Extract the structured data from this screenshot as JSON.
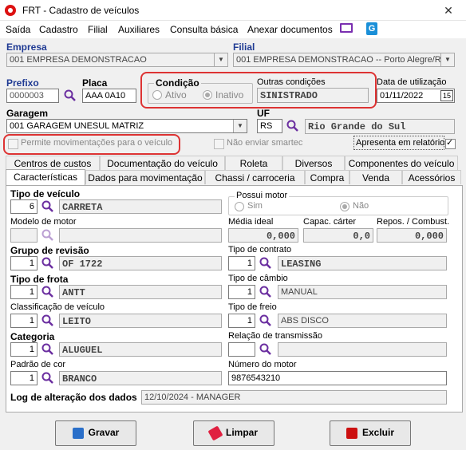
{
  "window": {
    "title": "FRT - Cadastro de veículos"
  },
  "menu": [
    "Saída",
    "Cadastro",
    "Filial",
    "Auxiliares",
    "Consulta básica",
    "Anexar documentos"
  ],
  "empresa": {
    "label": "Empresa",
    "value": "001 EMPRESA DEMONSTRACAO"
  },
  "filial": {
    "label": "Filial",
    "value": "001 EMPRESA DEMONSTRACAO -- Porto Alegre/RS"
  },
  "prefixo": {
    "label": "Prefixo",
    "value": "0000003"
  },
  "placa": {
    "label": "Placa",
    "value": "AAA 0A10"
  },
  "condicao": {
    "label": "Condição",
    "options": [
      "Ativo",
      "Inativo"
    ],
    "selected": "Inativo"
  },
  "outras_condicoes": {
    "label": "Outras condições",
    "value": "SINISTRADO"
  },
  "data_utilizacao": {
    "label": "Data de utilização",
    "value": "01/11/2022",
    "btn": "15"
  },
  "garagem": {
    "label": "Garagem",
    "value": "001 GARAGEM UNESUL MATRIZ"
  },
  "uf": {
    "label": "UF",
    "code": "RS",
    "name": "Rio Grande do Sul"
  },
  "checks": {
    "permite_mov": "Permite movimentações para o veículo",
    "nao_enviar": "Não enviar smartec",
    "apresenta": "Apresenta em relatórios"
  },
  "tabs_row1": [
    "Centros de custos",
    "Documentação do veículo",
    "Roleta",
    "Diversos",
    "Componentes do veículo"
  ],
  "tabs_row2": [
    "Características",
    "Dados para movimentação",
    "Chassi / carroceria",
    "Compra",
    "Venda",
    "Acessórios"
  ],
  "left": {
    "tipo_veiculo": {
      "label": "Tipo de veículo",
      "code": "6",
      "desc": "CARRETA"
    },
    "modelo_motor": {
      "label": "Modelo de motor",
      "code": "",
      "desc": ""
    },
    "grupo_revisao": {
      "label": "Grupo de revisão",
      "code": "1",
      "desc": "OF 1722"
    },
    "tipo_frota": {
      "label": "Tipo de frota",
      "code": "1",
      "desc": "ANTT"
    },
    "classificacao": {
      "label": "Classificação de veículo",
      "code": "1",
      "desc": "LEITO"
    },
    "categoria": {
      "label": "Categoria",
      "code": "1",
      "desc": "ALUGUEL"
    },
    "padrao_cor": {
      "label": "Padrão de cor",
      "code": "1",
      "desc": "BRANCO"
    }
  },
  "right": {
    "possui_motor": {
      "label": "Possui motor",
      "options": [
        "Sim",
        "Não"
      ],
      "selected": "Não"
    },
    "media_ideal": {
      "label": "Média ideal",
      "value": "0,000"
    },
    "capac_carter": {
      "label": "Capac. cárter",
      "value": "0,0"
    },
    "repos_combust": {
      "label": "Repos. / Combust.",
      "value": "0,000"
    },
    "tipo_contrato": {
      "label": "Tipo de contrato",
      "code": "1",
      "desc": "LEASING"
    },
    "tipo_cambio": {
      "label": "Tipo de câmbio",
      "code": "1",
      "desc": "MANUAL"
    },
    "tipo_freio": {
      "label": "Tipo de freio",
      "code": "1",
      "desc": "ABS DISCO"
    },
    "relacao_transmissao": {
      "label": "Relação de transmissão",
      "code": "",
      "desc": ""
    },
    "numero_motor": {
      "label": "Número do motor",
      "value": "9876543210"
    }
  },
  "log": {
    "label": "Log de alteração dos dados",
    "value": "12/10/2024 - MANAGER"
  },
  "buttons": {
    "gravar": "Gravar",
    "limpar": "Limpar",
    "excluir": "Excluir"
  },
  "colors": {
    "accent_red": "#d33333",
    "label_blue": "#1f3a93",
    "magnifier": "#6b2fa0"
  }
}
